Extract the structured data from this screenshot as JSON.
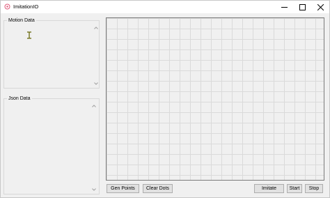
{
  "window": {
    "title": "ImitationIO"
  },
  "motion_group": {
    "label": "Motion Data"
  },
  "json_group": {
    "label": "Json Data"
  },
  "buttons": {
    "gen_points": "Gen Points",
    "clear_dots": "Clear Dots",
    "imitate": "Imitate",
    "start": "Start",
    "stop": "Stop"
  },
  "icons": {
    "app": "app-icon",
    "minimize": "minimize-icon",
    "maximize": "maximize-icon",
    "close": "close-icon",
    "text_cursor": "text-cursor-icon"
  },
  "colors": {
    "grid": "#dadada",
    "cursor": "#7a7a2a",
    "app_icon": "#e05a7a"
  }
}
